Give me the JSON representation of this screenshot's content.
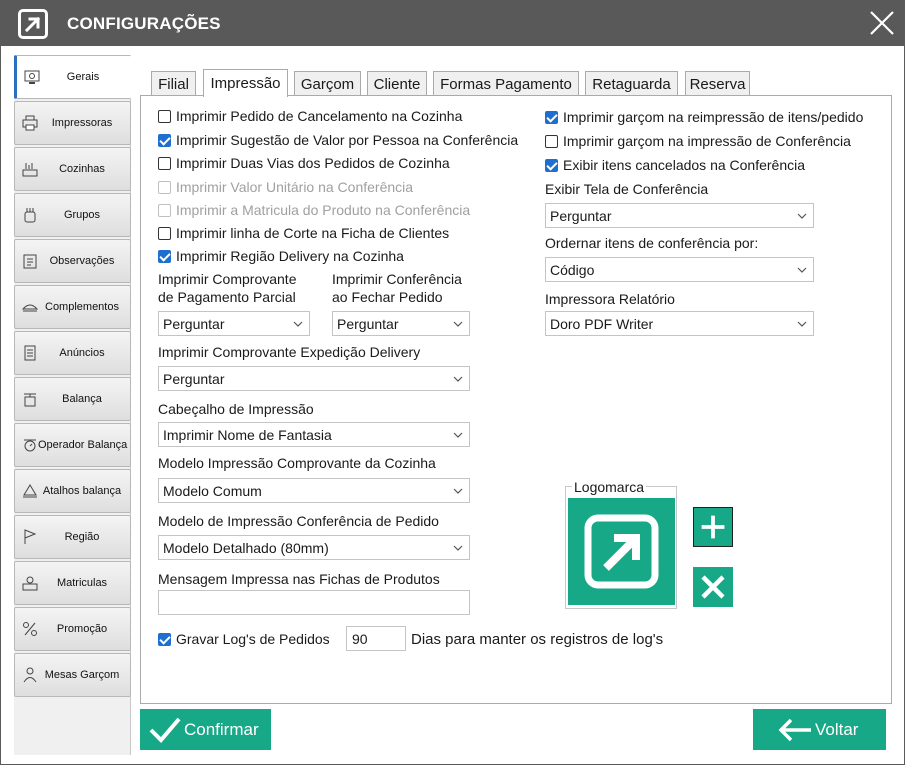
{
  "window": {
    "title": "CONFIGURAÇÕES"
  },
  "sidebar": {
    "items": [
      {
        "label": "Gerais",
        "icon": "general-settings-icon",
        "active": true
      },
      {
        "label": "Impressoras",
        "icon": "printer-icon"
      },
      {
        "label": "Cozinhas",
        "icon": "kitchen-icon"
      },
      {
        "label": "Grupos",
        "icon": "groups-icon"
      },
      {
        "label": "Observações",
        "icon": "clipboard-icon"
      },
      {
        "label": "Complementos",
        "icon": "dish-icon"
      },
      {
        "label": "Anúncios",
        "icon": "document-icon"
      },
      {
        "label": "Balança",
        "icon": "scale-icon"
      },
      {
        "label": "Operador Balança",
        "icon": "scale-operator-icon"
      },
      {
        "label": "Atalhos balança",
        "icon": "scale-shortcut-icon"
      },
      {
        "label": "Região",
        "icon": "flag-icon"
      },
      {
        "label": "Matriculas",
        "icon": "registration-icon"
      },
      {
        "label": "Promoção",
        "icon": "promotion-icon"
      },
      {
        "label": "Mesas Garçom",
        "icon": "waiter-icon"
      }
    ]
  },
  "tabs": [
    "Filial",
    "Impressão",
    "Garçom",
    "Cliente",
    "Formas Pagamento",
    "Retaguarda",
    "Reserva"
  ],
  "active_tab": "Impressão",
  "left_checks": [
    {
      "label": "Imprimir Pedido de Cancelamento na Cozinha",
      "checked": false,
      "disabled": false
    },
    {
      "label": "Imprimir Sugestão de Valor por Pessoa na Conferência",
      "checked": true,
      "disabled": false
    },
    {
      "label": "Imprimir Duas Vias dos Pedidos de Cozinha",
      "checked": false,
      "disabled": false
    },
    {
      "label": "Imprimir Valor Unitário na Conferência",
      "checked": false,
      "disabled": true
    },
    {
      "label": "Imprimir a Matricula do Produto na Conferência",
      "checked": false,
      "disabled": true
    },
    {
      "label": "Imprimir linha de Corte na Ficha de Clientes",
      "checked": false,
      "disabled": false
    },
    {
      "label": "Imprimir Região Delivery na Cozinha",
      "checked": true,
      "disabled": false
    }
  ],
  "right_checks": [
    {
      "label": "Imprimir garçom na reimpressão de itens/pedido",
      "checked": true
    },
    {
      "label": "Imprimir garçom na impressão de Conferência",
      "checked": false
    },
    {
      "label": "Exibir itens cancelados na Conferência",
      "checked": true
    }
  ],
  "fields": {
    "comprovante_parcial": {
      "label1": "Imprimir Comprovante",
      "label2": "de Pagamento Parcial",
      "value": "Perguntar"
    },
    "conferencia_fechar": {
      "label1": "Imprimir Conferência",
      "label2": "ao Fechar Pedido",
      "value": "Perguntar"
    },
    "expedicao_delivery": {
      "label": "Imprimir Comprovante Expedição Delivery",
      "value": "Perguntar"
    },
    "cabecalho": {
      "label": "Cabeçalho de Impressão",
      "value": "Imprimir Nome de Fantasia"
    },
    "modelo_cozinha": {
      "label": "Modelo Impressão Comprovante da Cozinha",
      "value": "Modelo Comum"
    },
    "modelo_conferencia": {
      "label": "Modelo de Impressão Conferência de Pedido",
      "value": "Modelo Detalhado (80mm)"
    },
    "mensagem_fichas": {
      "label": "Mensagem Impressa nas Fichas de Produtos",
      "value": ""
    },
    "exibir_tela": {
      "label": "Exibir Tela de Conferência",
      "value": "Perguntar"
    },
    "ordenar_itens": {
      "label": "Ordernar itens de conferência por:",
      "value": "Código"
    },
    "impressora_relatorio": {
      "label": "Impressora Relatório",
      "value": "Doro PDF Writer"
    }
  },
  "log": {
    "label": "Gravar Log's de Pedidos",
    "checked": true,
    "days": "90",
    "suffix": "Dias para manter os registros de log's"
  },
  "logo": {
    "label": "Logomarca"
  },
  "buttons": {
    "confirm": "Confirmar",
    "back": "Voltar"
  },
  "colors": {
    "accent": "#17a887",
    "titlebar": "#595959",
    "check": "#1e6fcf"
  }
}
